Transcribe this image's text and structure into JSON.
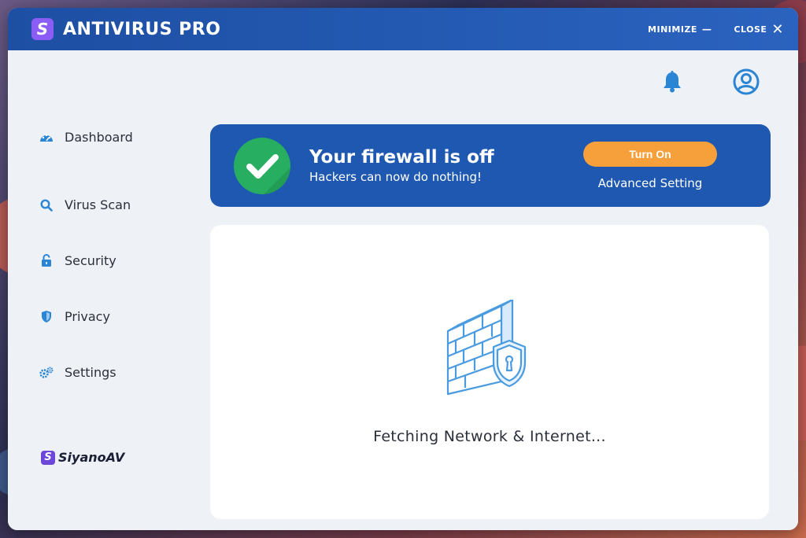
{
  "window": {
    "app_title": "ANTIVIRUS PRO",
    "logo_letter": "S",
    "minimize_label": "MINIMIZE",
    "minimize_glyph": "—",
    "close_label": "CLOSE",
    "close_glyph": "✕"
  },
  "header_icons": [
    {
      "name": "bell-icon"
    },
    {
      "name": "user-icon"
    }
  ],
  "sidebar": {
    "items": [
      {
        "label": "Dashboard",
        "icon": "dashboard-icon"
      },
      {
        "label": "Virus Scan",
        "icon": "search-icon"
      },
      {
        "label": "Security",
        "icon": "lock-icon"
      },
      {
        "label": "Privacy",
        "icon": "shield-icon"
      },
      {
        "label": "Settings",
        "icon": "gear-icon"
      }
    ]
  },
  "brand": {
    "logo_letter": "S",
    "name": "SiyanoAV"
  },
  "alert": {
    "title": "Your firewall is off",
    "subtitle": "Hackers can now do nothing!",
    "primary_button": "Turn On",
    "secondary_link": "Advanced Setting",
    "icon": "check-icon"
  },
  "content": {
    "illustration": "firewall-shield-icon",
    "status": "Fetching Network & Internet..."
  },
  "colors": {
    "titlebar": "#1d4fa3",
    "banner": "#1e58b0",
    "accent_orange": "#f5a03a",
    "check_green": "#27ae60",
    "icon_blue": "#2a86d4"
  }
}
